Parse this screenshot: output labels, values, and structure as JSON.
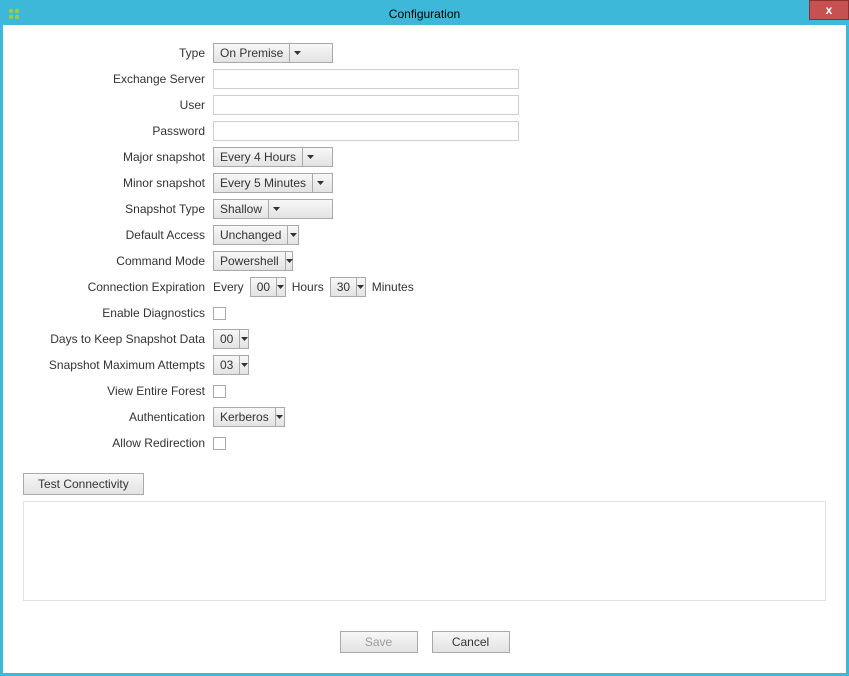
{
  "window": {
    "title": "Configuration",
    "close": "x"
  },
  "labels": {
    "type": "Type",
    "exchange_server": "Exchange Server",
    "user": "User",
    "password": "Password",
    "major_snapshot": "Major snapshot",
    "minor_snapshot": "Minor snapshot",
    "snapshot_type": "Snapshot Type",
    "default_access": "Default Access",
    "command_mode": "Command Mode",
    "connection_expiration": "Connection Expiration",
    "enable_diagnostics": "Enable Diagnostics",
    "days_keep": "Days to Keep Snapshot Data",
    "snapshot_max": "Snapshot Maximum Attempts",
    "view_forest": "View Entire Forest",
    "authentication": "Authentication",
    "allow_redirection": "Allow Redirection",
    "every": "Every",
    "hours": "Hours",
    "minutes": "Minutes"
  },
  "values": {
    "type": "On Premise",
    "exchange_server": "",
    "user": "",
    "password": "",
    "major_snapshot": "Every 4 Hours",
    "minor_snapshot": "Every 5 Minutes",
    "snapshot_type": "Shallow",
    "default_access": "Unchanged",
    "command_mode": "Powershell",
    "conn_hours": "00",
    "conn_minutes": "30",
    "days_keep": "00",
    "snapshot_max": "03",
    "authentication": "Kerberos"
  },
  "buttons": {
    "test": "Test Connectivity",
    "save": "Save",
    "cancel": "Cancel"
  }
}
